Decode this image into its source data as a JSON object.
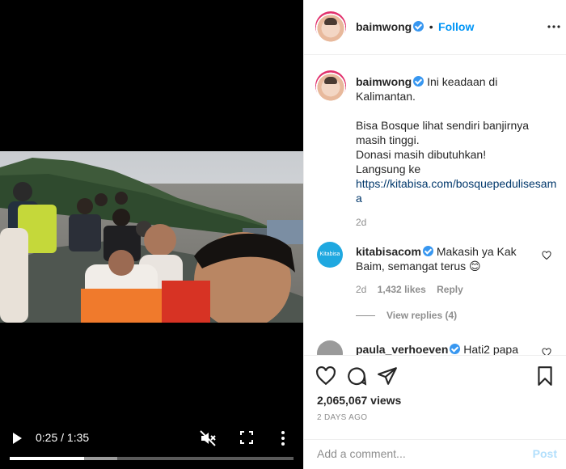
{
  "video": {
    "time": "0:25 / 1:35",
    "progress": 0.263,
    "buffered": 0.38
  },
  "header": {
    "username": "baimwong",
    "follow_label": "Follow",
    "separator": "•"
  },
  "caption": {
    "username": "baimwong",
    "line1": "Ini keadaan di Kalimantan.",
    "line2": "Bisa Bosque lihat sendiri banjirnya masih tinggi.",
    "line3": "Donasi masih dibutuhkan!",
    "line4": "Langsung ke",
    "link": "https://kitabisa.com/bosquepedulisesama",
    "age": "2d"
  },
  "comments": [
    {
      "username": "kitabisacom",
      "avatar_text": "Kitabisa",
      "text": "Makasih ya Kak Baim, semangat terus 😊",
      "age": "2d",
      "likes": "1,432 likes",
      "reply_label": "Reply",
      "view_replies": "View replies (4)"
    },
    {
      "username": "paula_verhoeven",
      "text": "Hati2 papa"
    }
  ],
  "footer": {
    "views": "2,065,067 views",
    "posted": "2 DAYS AGO",
    "comment_placeholder": "Add a comment...",
    "post_label": "Post"
  },
  "colors": {
    "accent": "#0095f6",
    "verified": "#3897f0",
    "muted": "#8e8e8e"
  }
}
